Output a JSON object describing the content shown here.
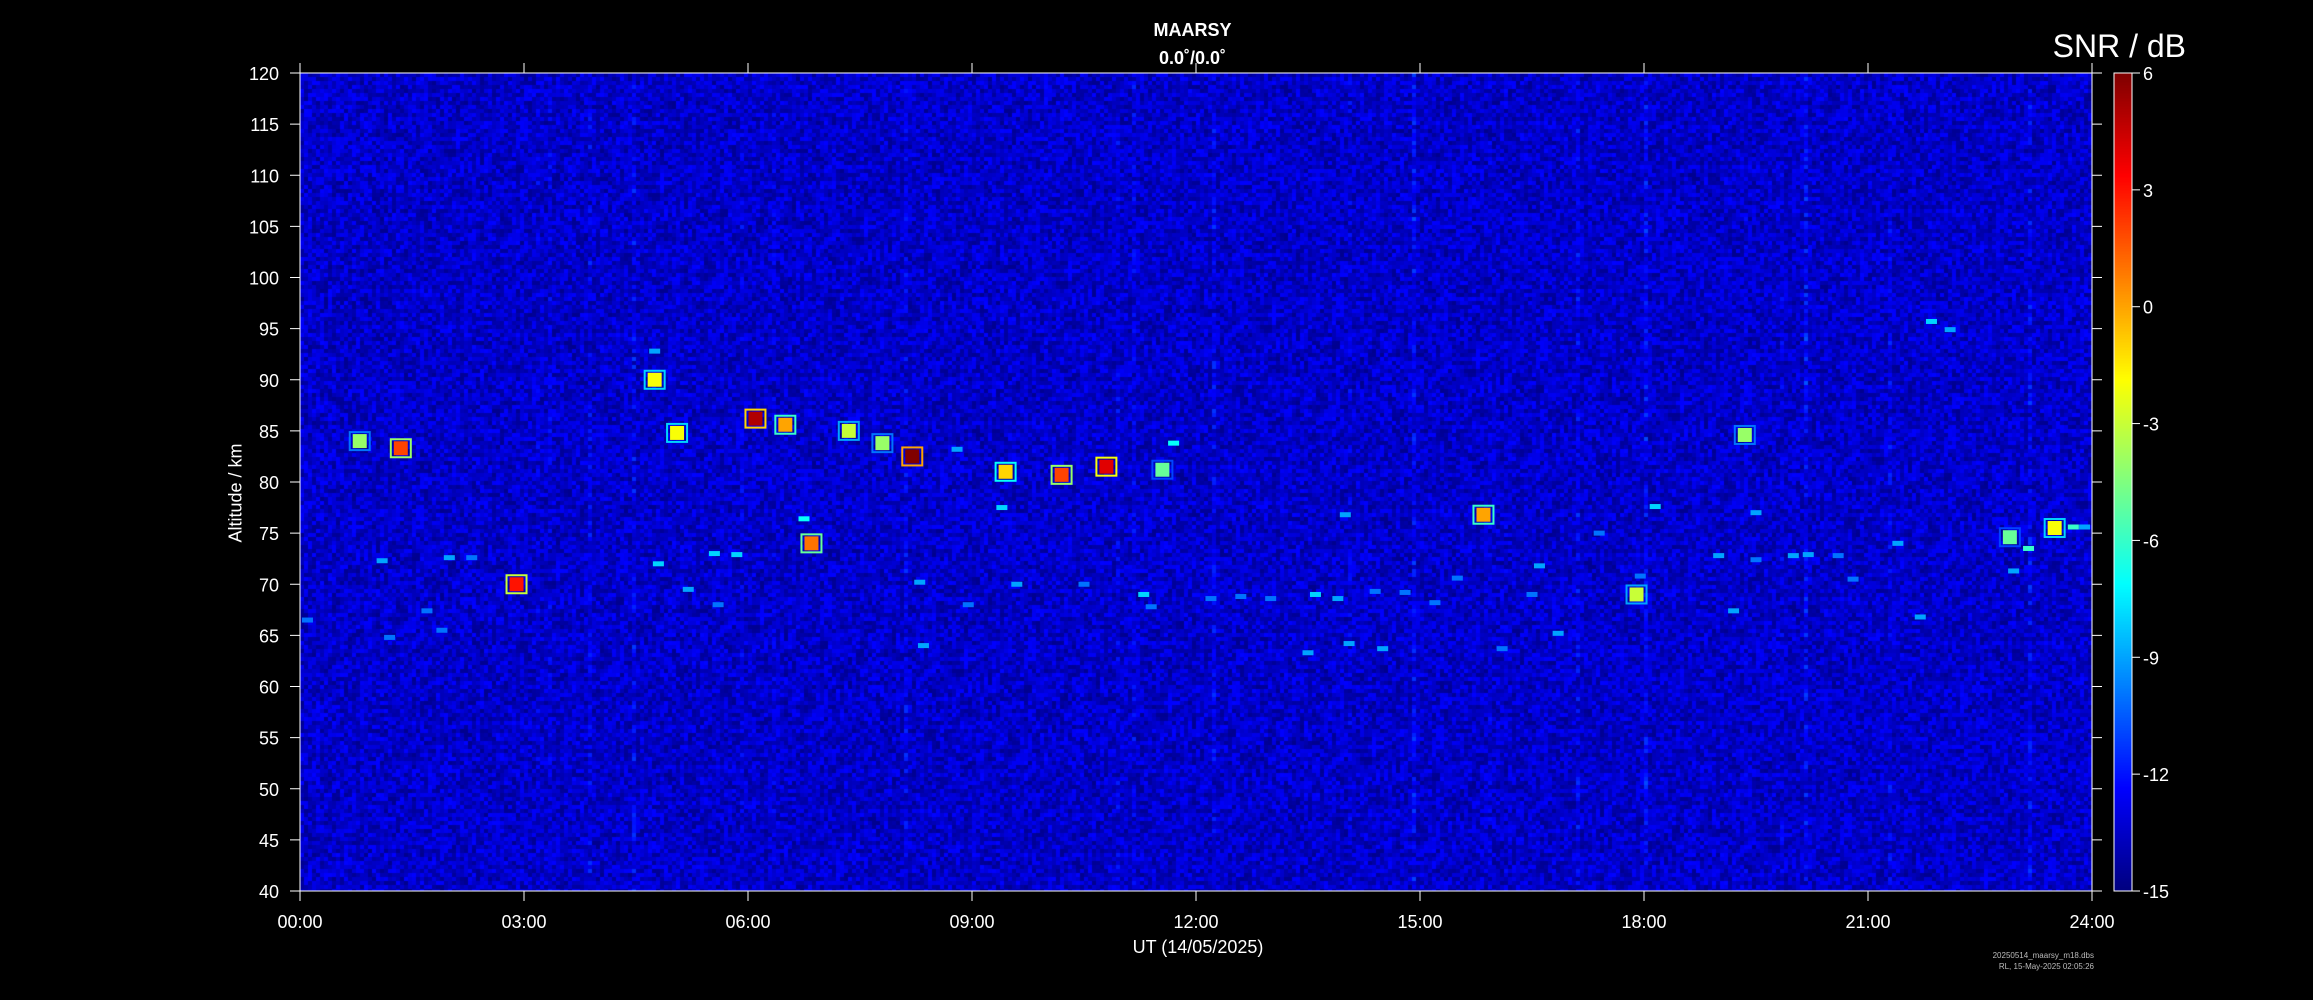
{
  "chart_data": {
    "type": "heatmap",
    "title": "MAARSY",
    "subtitle": "0.0˚/0.0˚",
    "xlabel": "UT (14/05/2025)",
    "ylabel": "Altitude / km",
    "colorbar_label": "SNR / dB",
    "colormap": "jet",
    "xlim_hours": [
      0,
      24
    ],
    "ylim": [
      40,
      120
    ],
    "clim": [
      -15,
      6
    ],
    "x_ticks": [
      "00:00",
      "03:00",
      "06:00",
      "09:00",
      "12:00",
      "15:00",
      "18:00",
      "21:00",
      "24:00"
    ],
    "y_ticks": [
      40,
      45,
      50,
      55,
      60,
      65,
      70,
      75,
      80,
      85,
      90,
      95,
      100,
      105,
      110,
      115,
      120
    ],
    "colorbar_ticks": [
      6,
      3,
      0,
      -3,
      -6,
      -9,
      -12,
      -15
    ],
    "background_snr_db": -13.5,
    "echo_features": [
      {
        "t": 0.8,
        "alt": 84.0,
        "snr": -4
      },
      {
        "t": 1.35,
        "alt": 83.3,
        "snr": 2
      },
      {
        "t": 1.1,
        "alt": 72.3,
        "snr": -9
      },
      {
        "t": 2.0,
        "alt": 72.6,
        "snr": -9
      },
      {
        "t": 2.3,
        "alt": 72.6,
        "snr": -10
      },
      {
        "t": 2.9,
        "alt": 70.0,
        "snr": 3
      },
      {
        "t": 1.7,
        "alt": 67.4,
        "snr": -10
      },
      {
        "t": 1.9,
        "alt": 65.5,
        "snr": -10
      },
      {
        "t": 1.2,
        "alt": 64.8,
        "snr": -10
      },
      {
        "t": 0.1,
        "alt": 66.5,
        "snr": -10
      },
      {
        "t": 5.05,
        "alt": 84.8,
        "snr": -2
      },
      {
        "t": 5.2,
        "alt": 69.5,
        "snr": -9
      },
      {
        "t": 5.55,
        "alt": 73.0,
        "snr": -8
      },
      {
        "t": 5.85,
        "alt": 72.9,
        "snr": -8
      },
      {
        "t": 5.6,
        "alt": 68.0,
        "snr": -10
      },
      {
        "t": 6.1,
        "alt": 86.2,
        "snr": 5
      },
      {
        "t": 6.5,
        "alt": 85.6,
        "snr": 0
      },
      {
        "t": 6.75,
        "alt": 76.4,
        "snr": -7
      },
      {
        "t": 6.85,
        "alt": 74.0,
        "snr": 1
      },
      {
        "t": 7.35,
        "alt": 85.0,
        "snr": -3
      },
      {
        "t": 7.8,
        "alt": 83.8,
        "snr": -4
      },
      {
        "t": 8.2,
        "alt": 82.5,
        "snr": 6
      },
      {
        "t": 8.3,
        "alt": 70.2,
        "snr": -9
      },
      {
        "t": 8.35,
        "alt": 64.0,
        "snr": -9
      },
      {
        "t": 8.8,
        "alt": 83.2,
        "snr": -9
      },
      {
        "t": 8.95,
        "alt": 68.0,
        "snr": -10
      },
      {
        "t": 9.45,
        "alt": 81.0,
        "snr": -1
      },
      {
        "t": 9.4,
        "alt": 77.5,
        "snr": -8
      },
      {
        "t": 9.6,
        "alt": 70.0,
        "snr": -9
      },
      {
        "t": 10.2,
        "alt": 80.7,
        "snr": 2
      },
      {
        "t": 10.8,
        "alt": 81.5,
        "snr": 4
      },
      {
        "t": 10.5,
        "alt": 70.0,
        "snr": -10
      },
      {
        "t": 11.55,
        "alt": 81.2,
        "snr": -5
      },
      {
        "t": 11.7,
        "alt": 83.8,
        "snr": -7
      },
      {
        "t": 11.3,
        "alt": 69.0,
        "snr": -8
      },
      {
        "t": 11.4,
        "alt": 67.8,
        "snr": -10
      },
      {
        "t": 12.2,
        "alt": 68.6,
        "snr": -10
      },
      {
        "t": 12.6,
        "alt": 68.8,
        "snr": -10
      },
      {
        "t": 13.0,
        "alt": 68.6,
        "snr": -10
      },
      {
        "t": 13.6,
        "alt": 69.0,
        "snr": -8
      },
      {
        "t": 13.9,
        "alt": 68.6,
        "snr": -9
      },
      {
        "t": 13.5,
        "alt": 63.3,
        "snr": -9
      },
      {
        "t": 14.05,
        "alt": 64.2,
        "snr": -9
      },
      {
        "t": 14.5,
        "alt": 63.7,
        "snr": -9
      },
      {
        "t": 14.0,
        "alt": 76.8,
        "snr": -9
      },
      {
        "t": 14.4,
        "alt": 69.3,
        "snr": -10
      },
      {
        "t": 14.8,
        "alt": 69.2,
        "snr": -10
      },
      {
        "t": 15.2,
        "alt": 68.2,
        "snr": -10
      },
      {
        "t": 15.5,
        "alt": 70.6,
        "snr": -10
      },
      {
        "t": 15.85,
        "alt": 76.8,
        "snr": 0
      },
      {
        "t": 16.1,
        "alt": 63.7,
        "snr": -10
      },
      {
        "t": 16.5,
        "alt": 69.0,
        "snr": -10
      },
      {
        "t": 16.6,
        "alt": 71.8,
        "snr": -9
      },
      {
        "t": 16.85,
        "alt": 65.2,
        "snr": -9
      },
      {
        "t": 17.4,
        "alt": 75.0,
        "snr": -10
      },
      {
        "t": 17.9,
        "alt": 69.0,
        "snr": -3
      },
      {
        "t": 17.95,
        "alt": 70.8,
        "snr": -10
      },
      {
        "t": 18.15,
        "alt": 77.6,
        "snr": -8
      },
      {
        "t": 19.0,
        "alt": 72.8,
        "snr": -9
      },
      {
        "t": 19.2,
        "alt": 67.4,
        "snr": -9
      },
      {
        "t": 19.35,
        "alt": 84.6,
        "snr": -4
      },
      {
        "t": 19.5,
        "alt": 77.0,
        "snr": -9
      },
      {
        "t": 19.5,
        "alt": 72.4,
        "snr": -10
      },
      {
        "t": 20.0,
        "alt": 72.8,
        "snr": -9
      },
      {
        "t": 20.2,
        "alt": 72.9,
        "snr": -9
      },
      {
        "t": 20.6,
        "alt": 72.8,
        "snr": -10
      },
      {
        "t": 20.8,
        "alt": 70.5,
        "snr": -10
      },
      {
        "t": 21.4,
        "alt": 74.0,
        "snr": -9
      },
      {
        "t": 21.7,
        "alt": 66.8,
        "snr": -9
      },
      {
        "t": 21.85,
        "alt": 95.7,
        "snr": -8
      },
      {
        "t": 22.1,
        "alt": 94.9,
        "snr": -9
      },
      {
        "t": 22.9,
        "alt": 74.6,
        "snr": -5
      },
      {
        "t": 23.15,
        "alt": 73.5,
        "snr": -6
      },
      {
        "t": 23.5,
        "alt": 75.5,
        "snr": -2
      },
      {
        "t": 23.75,
        "alt": 75.6,
        "snr": -6
      },
      {
        "t": 23.9,
        "alt": 75.6,
        "snr": -9
      },
      {
        "t": 22.95,
        "alt": 71.3,
        "snr": -9
      },
      {
        "t": 4.75,
        "alt": 92.8,
        "snr": -9
      },
      {
        "t": 4.75,
        "alt": 90.0,
        "snr": -2
      },
      {
        "t": 4.8,
        "alt": 72.0,
        "snr": -8
      }
    ]
  },
  "footnote": [
    "20250514_maarsy_m18.dbs",
    "RL, 15-May-2025 02:05:26"
  ]
}
